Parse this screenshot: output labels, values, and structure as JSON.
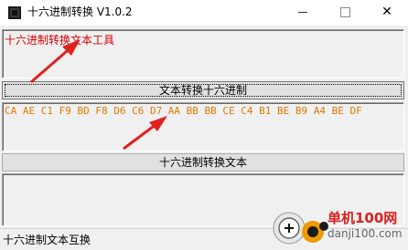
{
  "window": {
    "title": "十六进制转换 V1.0.2",
    "controls": {
      "minimize": "minimize",
      "maximize": "maximize",
      "close": "✕"
    }
  },
  "text_box": {
    "value": "十六进制转换文本工具"
  },
  "to_hex_button": {
    "label": "文本转换十六进制"
  },
  "hex_box": {
    "value": "CA AE C1 F9 BD F8 D6 C6 D7 AA BB BB CE C4 B1 BE B9 A4 BE DF"
  },
  "to_text_button": {
    "label": "十六进制转换文本"
  },
  "output_box": {
    "value": ""
  },
  "status_bar": {
    "text": "十六进制文本互换"
  },
  "watermark": {
    "brand": "单机100网",
    "site": "danji100.com"
  },
  "colors": {
    "text_box_color": "#d40000",
    "hex_color": "#e07800",
    "arrow_color": "#e32020"
  }
}
